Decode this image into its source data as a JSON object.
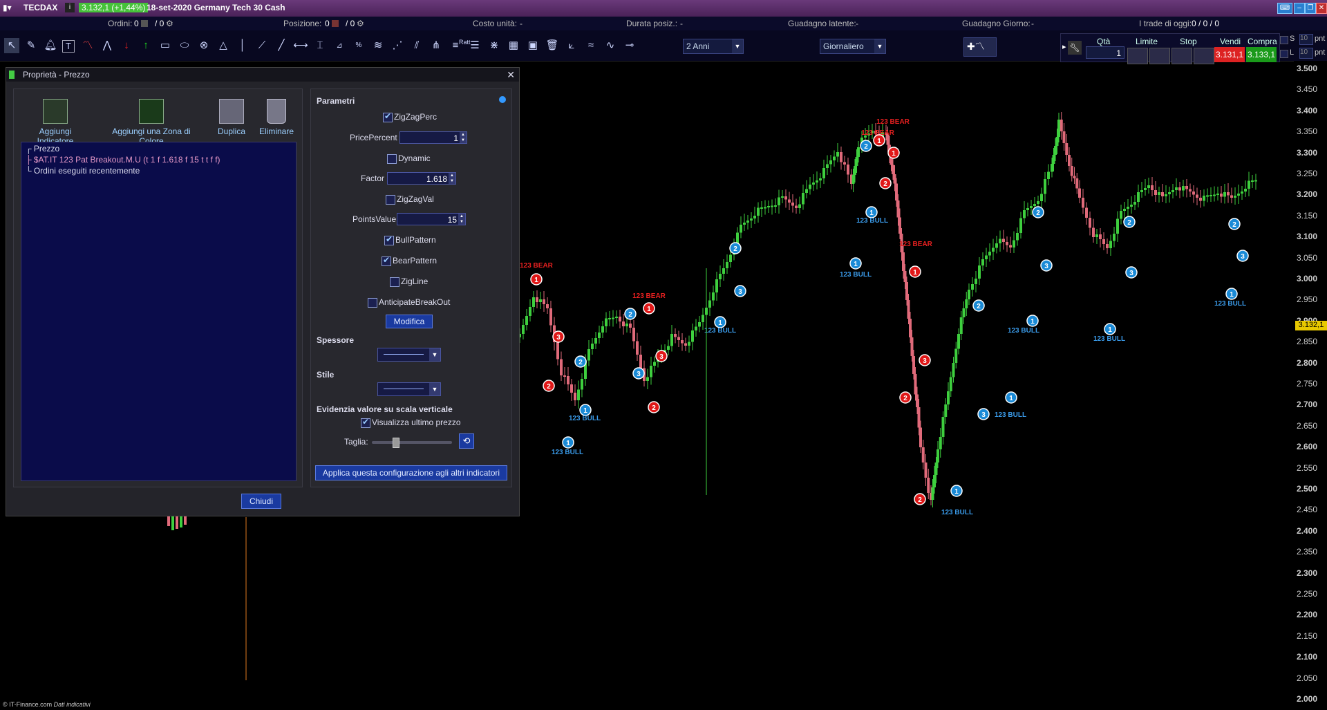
{
  "titlebar": {
    "symbol": "TECDAX",
    "price_badge": "3.132,1 (+1,44%)",
    "instrument": "18-set-2020 Germany Tech 30 Cash"
  },
  "statusbar": {
    "orders_label": "Ordini:",
    "orders_value": "0",
    "orders_value2": "/ 0",
    "position_label": "Posizione:",
    "position_value": "0",
    "position_value2": "/ 0",
    "unit_cost_label": "Costo unità:",
    "unit_cost_value": "-",
    "duration_label": "Durata posiz.:",
    "duration_value": "-",
    "latent_gain_label": "Guadagno latente:",
    "latent_gain_value": "-",
    "day_gain_label": "Guadagno Giorno:",
    "day_gain_value": "-",
    "trades_today_label": "I trade di oggi:",
    "trades_today_value": "0 / 0 / 0"
  },
  "toolbar": {
    "period": "2 Anni",
    "interval": "Giornaliero",
    "ratt_label": "Ratt",
    "qty_label": "Qtà",
    "qty_value": "1",
    "limit_label": "Limite",
    "stop_label": "Stop",
    "sell_label": "Vendi",
    "buy_label": "Compra",
    "sell_price": "3.131,1",
    "buy_price": "3.133,1",
    "s_label": "S",
    "l_label": "L",
    "pnt_label": "pnt",
    "s_qty": "10",
    "l_qty": "10"
  },
  "yaxis": {
    "ticks": [
      "3.500",
      "3.450",
      "3.400",
      "3.350",
      "3.300",
      "3.250",
      "3.200",
      "3.150",
      "3.100",
      "3.050",
      "3.000",
      "2.950",
      "2.900",
      "2.850",
      "2.800",
      "2.750",
      "2.700",
      "2.650",
      "2.600",
      "2.550",
      "2.500",
      "2.450",
      "2.400",
      "2.350",
      "2.300",
      "2.250",
      "2.200",
      "2.150",
      "2.100",
      "2.050",
      "2.000"
    ],
    "last_price": "3.132,1"
  },
  "dialog": {
    "title": "Proprietà - Prezzo",
    "add_indicator": "Aggiungi Indicatore",
    "add_color_zone": "Aggiungi una Zona di Colore",
    "duplicate": "Duplica",
    "delete": "Eliminare",
    "tree": [
      "Prezzo",
      "$AT.IT 123 Pat Breakout.M.U (t 1 f 1.618 f 15 t t f f)",
      "Ordini eseguiti recentemente"
    ],
    "params_title": "Parametri",
    "zigzagperc": "ZigZagPerc",
    "pricepercent_label": "PricePercent",
    "pricepercent_value": "1",
    "dynamic": "Dynamic",
    "factor_label": "Factor",
    "factor_value": "1.618",
    "zigzagval": "ZigZagVal",
    "pointsvalue_label": "PointsValue",
    "pointsvalue_value": "15",
    "bullpattern": "BullPattern",
    "bearpattern": "BearPattern",
    "zigline": "ZigLine",
    "anticipate": "AnticipateBreakOut",
    "modify": "Modifica",
    "thickness": "Spessore",
    "style": "Stile",
    "highlight": "Evidenzia valore su scala verticale",
    "show_last": "Visualizza ultimo prezzo",
    "size": "Taglia:",
    "apply_all": "Applica questa configurazione agli altri indicatori",
    "close": "Chiudi"
  },
  "chart": {
    "bear_label": "123 BEAR",
    "bull_label": "123 BULL",
    "overlap_bull": "123 BU123 BULL",
    "colors": {
      "up": "#3ecf3e",
      "down": "#e06a7a",
      "bull": "#1a8ad6",
      "bear": "#e01818"
    }
  },
  "footer": {
    "source": "© IT-Finance.com",
    "note": "Dati indicativi"
  }
}
